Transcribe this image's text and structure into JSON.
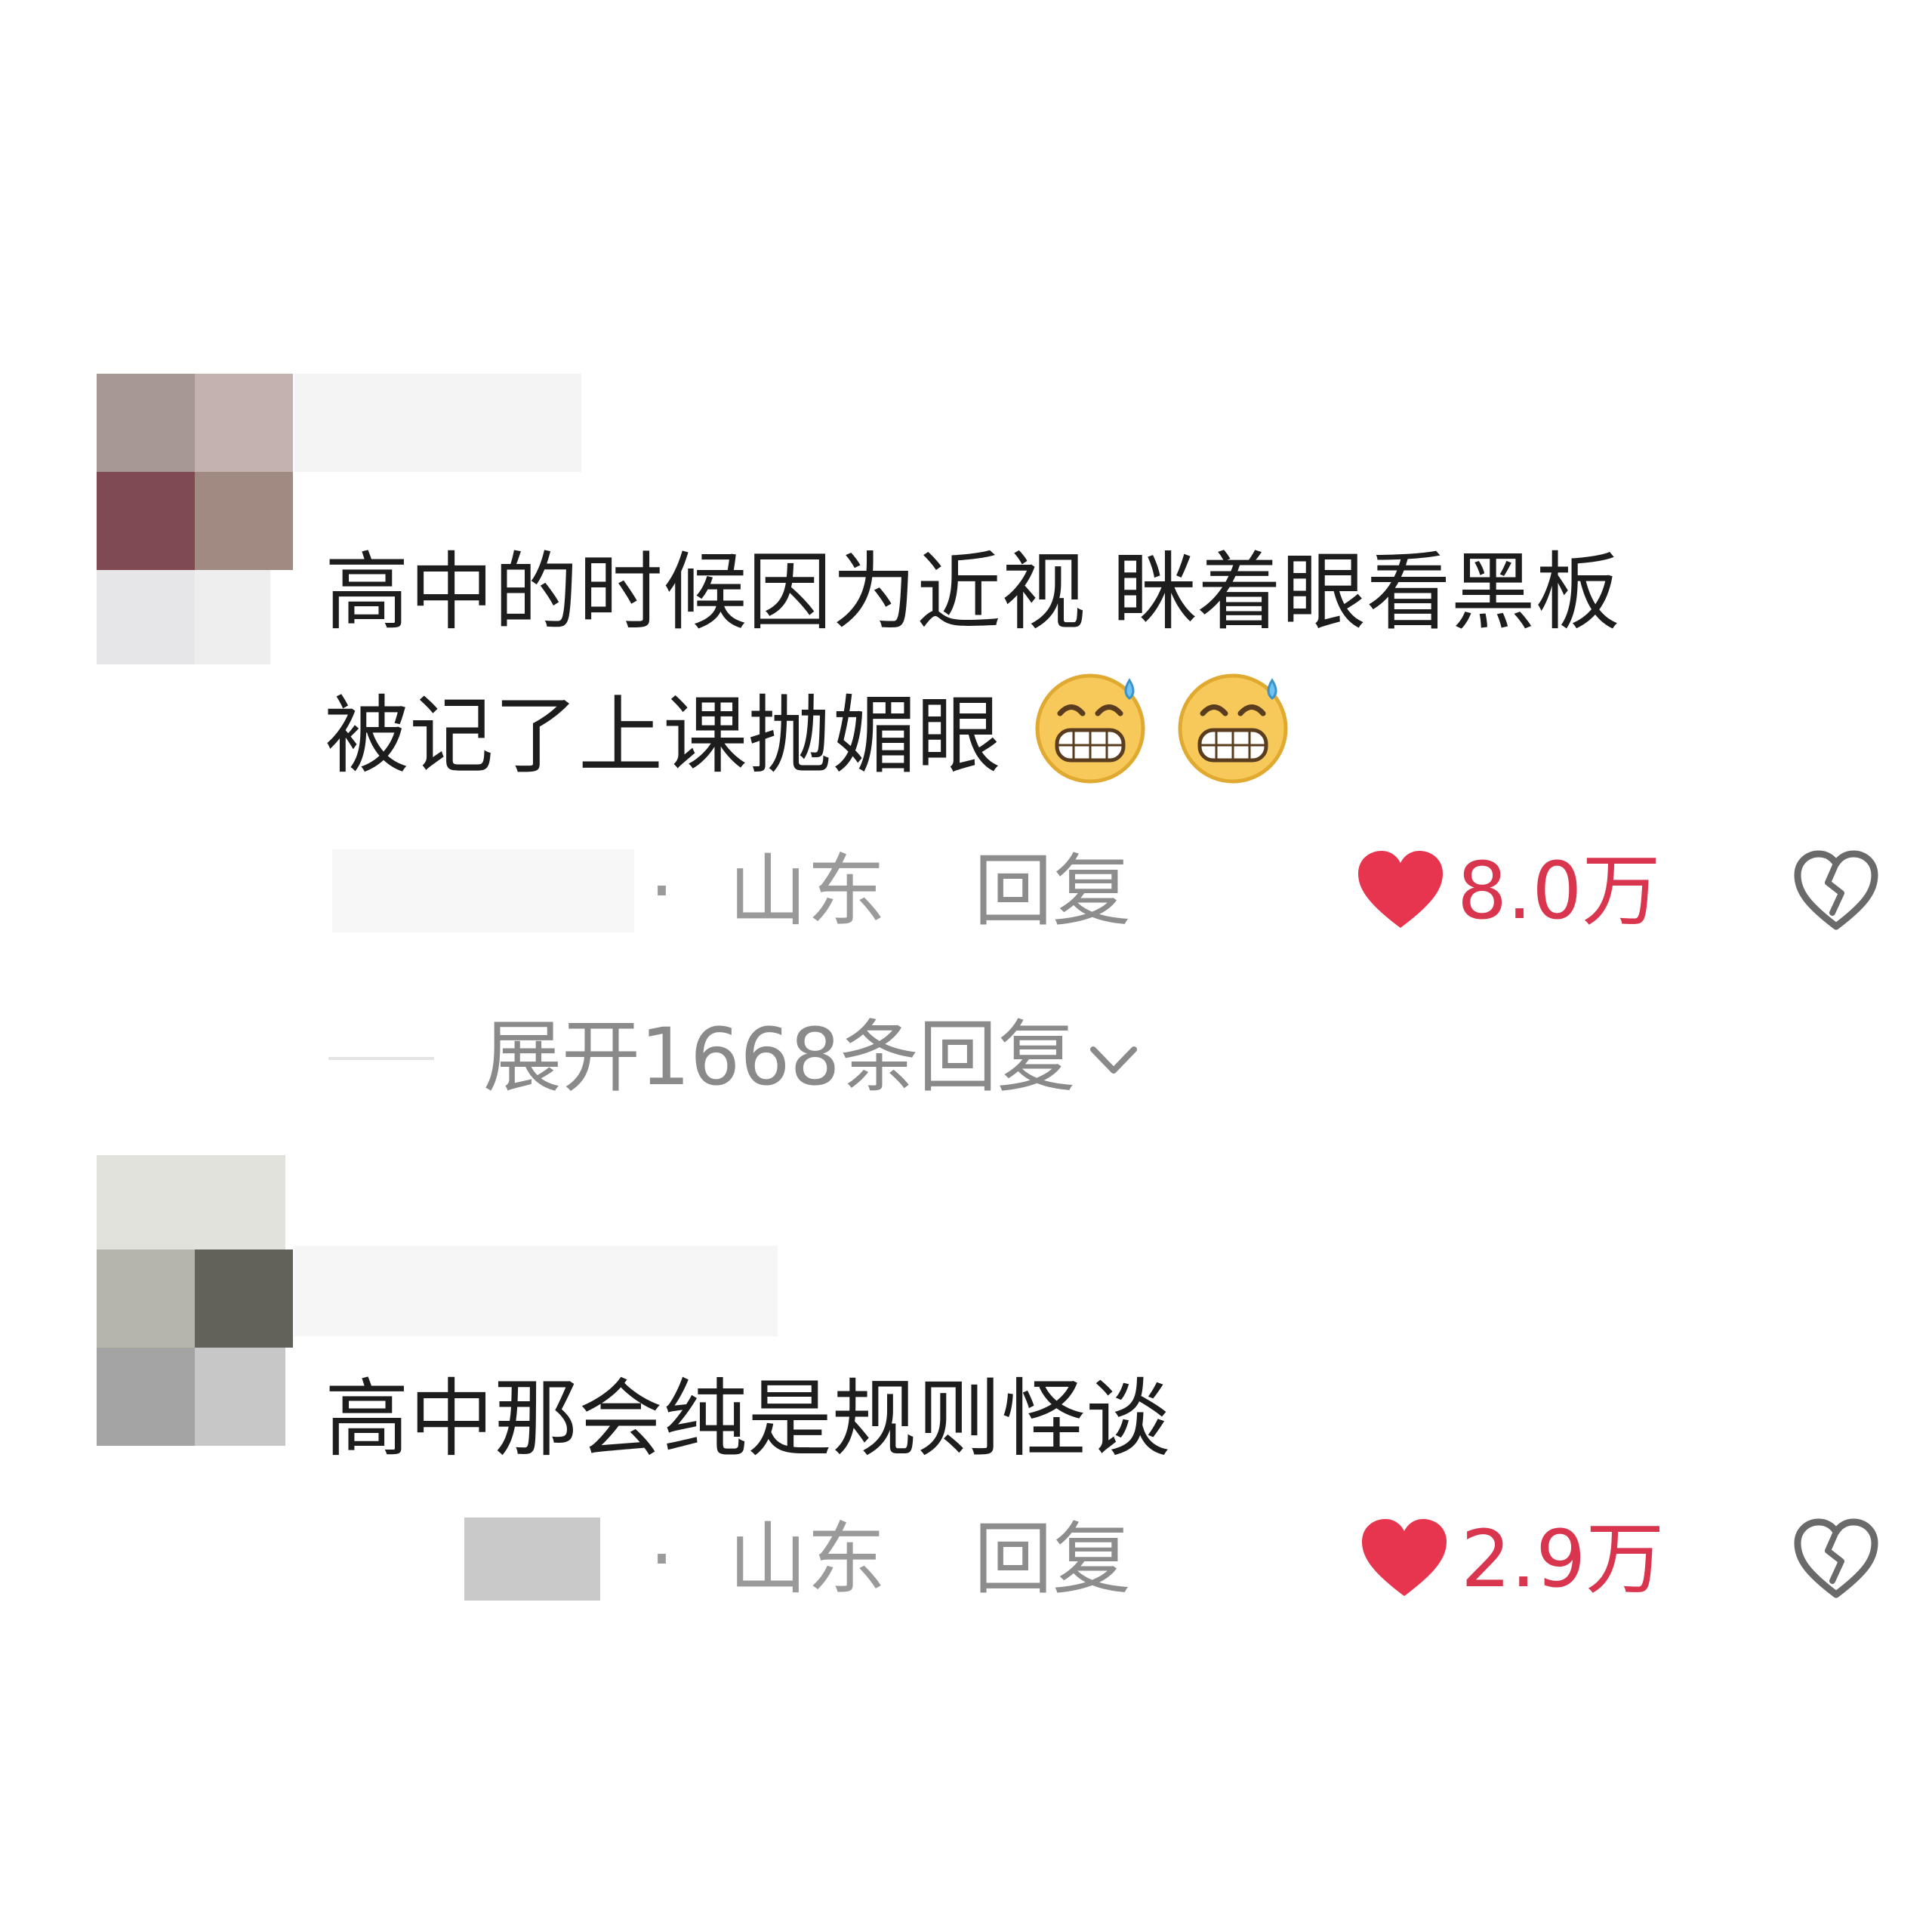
{
  "comments": [
    {
      "text_lines": [
        "高中的时候因为近视  眯着眼看黑板",
        "被记了上课抛媚眼"
      ],
      "emojis": [
        "grimace-sweat-emoji",
        "grimace-sweat-emoji"
      ],
      "separator": "·",
      "location": "山东",
      "reply_label": "回复",
      "likes": "8.0万",
      "expand_replies": "展开1668条回复"
    },
    {
      "text_lines": [
        "高中那会纯是规则怪谈"
      ],
      "separator": "·",
      "location": "山东",
      "reply_label": "回复",
      "likes": "2.9万"
    }
  ],
  "colors": {
    "like": "#e8354f",
    "like_text": "#d9354f",
    "meta_text": "#9a9a9a",
    "body_text": "#1d1d1d"
  },
  "icons": [
    "heart-icon",
    "dislike-broken-heart-icon",
    "chevron-down-icon"
  ]
}
